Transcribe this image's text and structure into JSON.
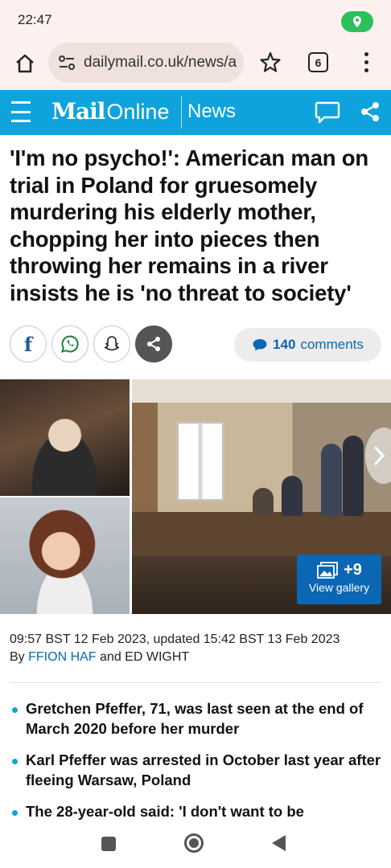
{
  "status_bar": {
    "time": "22:47"
  },
  "browser": {
    "url": "dailymail.co.uk/news/a",
    "tab_count": "6"
  },
  "site_header": {
    "logo_main": "Mail",
    "logo_suffix": "Online",
    "section": "News"
  },
  "article": {
    "headline": "'I'm no psycho!': American man on trial in Poland for gruesomely murdering his elderly mother, chopping her into pieces then throwing her remains in a river insists he is 'no threat to society'",
    "comments_count": "140",
    "comments_label": "comments",
    "gallery_count": "+9",
    "gallery_label": "View gallery",
    "timestamp": "09:57 BST 12 Feb 2023, updated 15:42 BST 13 Feb 2023",
    "by_label": "By",
    "author_1": "FFION HAF",
    "and_label": "and",
    "author_2": "ED WIGHT",
    "bullets": [
      "Gretchen Pfeffer, 71, was last seen at the end of March 2020 before her murder",
      "Karl Pfeffer was arrested in October last year after fleeing Warsaw, Poland",
      "The 28-year-old said: 'I don't want to be"
    ]
  },
  "colors": {
    "brand_blue": "#0fa3dd",
    "link_blue": "#0b67b3",
    "browser_bg": "#fdf1ef"
  },
  "icons": [
    "location-icon",
    "home-icon",
    "tune-icon",
    "star-icon",
    "tabs-icon",
    "overflow-menu-icon",
    "hamburger-icon",
    "chat-icon",
    "share-icon",
    "facebook-icon",
    "whatsapp-icon",
    "snapchat-icon",
    "comment-bubble-icon",
    "gallery-icon",
    "chevron-right-icon"
  ]
}
